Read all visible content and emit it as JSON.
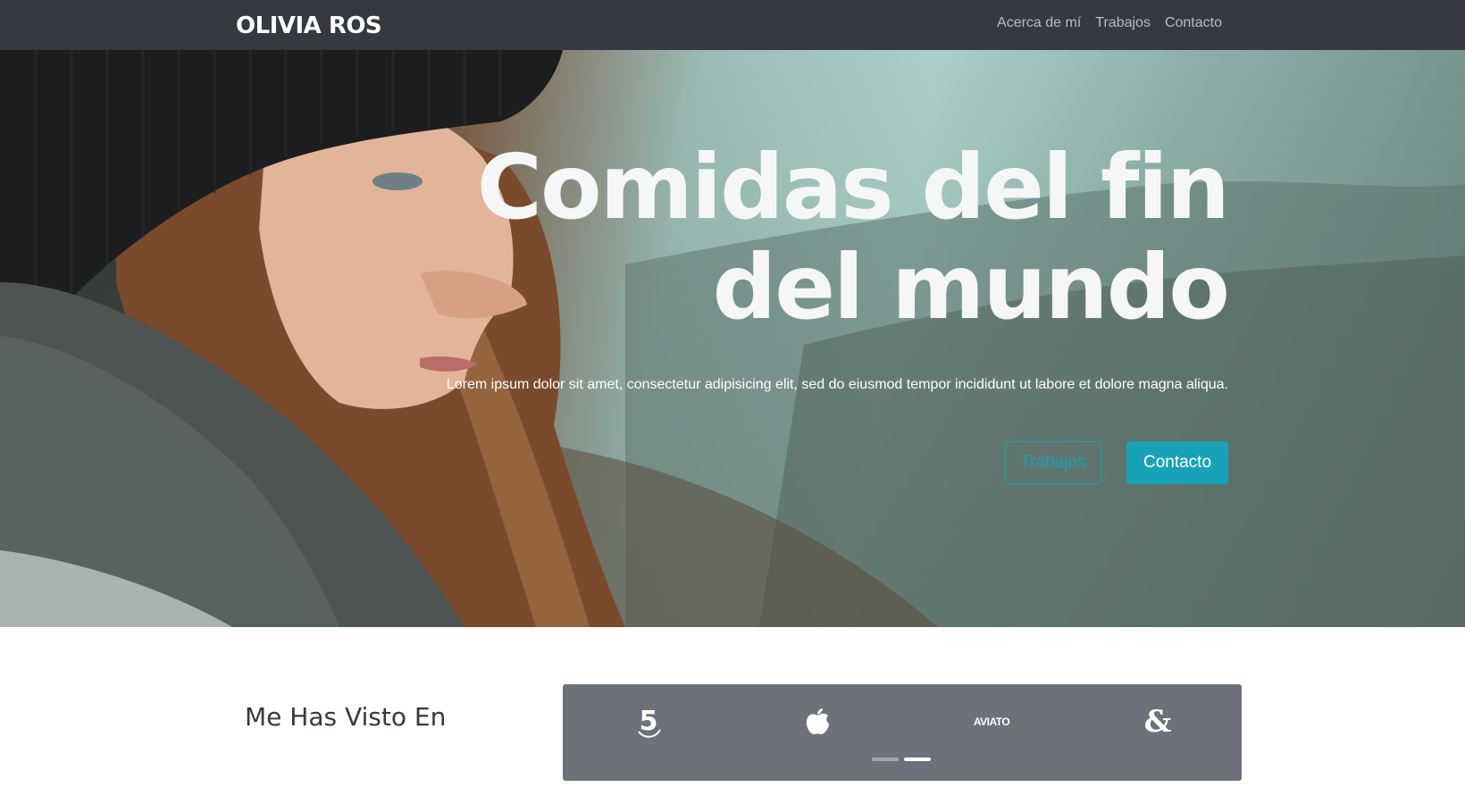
{
  "navbar": {
    "brand": "OLIVIA ROS",
    "links": [
      "Acerca de mí",
      "Trabajos",
      "Contacto"
    ]
  },
  "hero": {
    "title": "Comidas del fin del mundo",
    "subtitle": "Lorem ipsum dolor sit amet, consectetur adipisicing elit, sed do eiusmod tempor incididunt ut labore et dolore magna aliqua.",
    "btn_works": "Trabajos",
    "btn_contact": "Contacto"
  },
  "seen": {
    "title": "Me Has Visto En",
    "logos": [
      "five-icon",
      "apple-icon",
      "aviato-logo",
      "ampersand-icon"
    ],
    "aviato_text": "AVIATO"
  },
  "colors": {
    "navbar": "#343a40",
    "accent": "#17a2b8",
    "panel": "#6c717a"
  }
}
